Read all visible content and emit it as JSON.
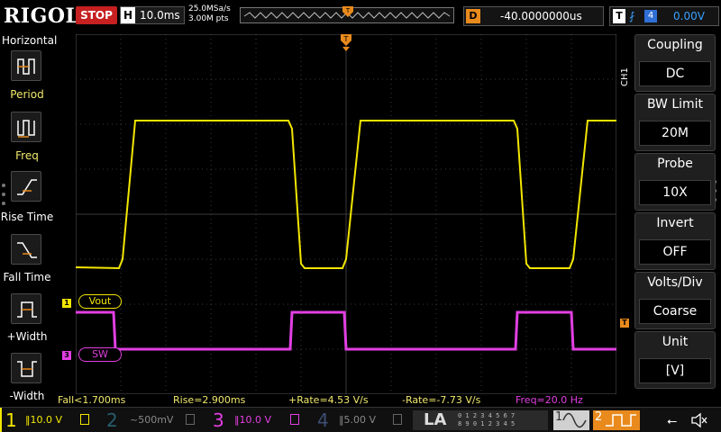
{
  "header": {
    "brand": "RIGOL",
    "run_state": "STOP",
    "timebase_label": "H",
    "timebase_value": "10.0ms",
    "sample_rate": "25.0MSa/s",
    "memory_depth": "3.00M pts",
    "delay_label": "D",
    "delay_value": "-40.0000000us",
    "trigger_label": "T",
    "trigger_source": "4",
    "trigger_level": "0.00V"
  },
  "left_menu": {
    "title": "Horizontal",
    "items": [
      {
        "label": "Period",
        "icon": "period-icon"
      },
      {
        "label": "Freq",
        "icon": "freq-icon"
      },
      {
        "label": "Rise Time",
        "icon": "rise-time-icon"
      },
      {
        "label": "Fall Time",
        "icon": "fall-time-icon"
      },
      {
        "label": "+Width",
        "icon": "pos-width-icon"
      },
      {
        "label": "-Width",
        "icon": "neg-width-icon"
      }
    ]
  },
  "channel_labels": {
    "ch1_marker": "1",
    "ch1_label": "Vout",
    "ch3_marker": "3",
    "ch3_label": "SW"
  },
  "right_menu": {
    "channel": "CH1",
    "groups": [
      {
        "title": "Coupling",
        "value": "DC",
        "arrow": true
      },
      {
        "title": "BW Limit",
        "value": "20M",
        "arrow": false
      },
      {
        "title": "Probe",
        "value": "10X",
        "arrow": true
      },
      {
        "title": "Invert",
        "value": "OFF",
        "arrow": false
      },
      {
        "title": "Volts/Div",
        "value": "Coarse",
        "arrow": false
      },
      {
        "title": "Unit",
        "value": "[V]",
        "arrow": true
      }
    ]
  },
  "measurements": [
    {
      "text": "Fall<1.700ms",
      "color": "#f0e86a"
    },
    {
      "text": "Rise=2.900ms",
      "color": "#f0e86a"
    },
    {
      "text": "+Rate=4.53 V/s",
      "color": "#f0e86a"
    },
    {
      "text": "-Rate=-7.73 V/s",
      "color": "#f0e86a"
    },
    {
      "text": "Freq=20.0 Hz",
      "color": "#e23fe2"
    }
  ],
  "channels": [
    {
      "num": "1",
      "scale": "10.0 V",
      "color": "#f2e600",
      "active": true
    },
    {
      "num": "2",
      "scale": "500mV",
      "color": "#3fa9c9",
      "active": false
    },
    {
      "num": "3",
      "scale": "10.0 V",
      "color": "#e23fe2",
      "active": true
    },
    {
      "num": "4",
      "scale": "5.00 V",
      "color": "#6a8dd8",
      "active": false
    }
  ],
  "la": {
    "label": "LA",
    "grid_row1": "0 1 2 3   4 5 6 7",
    "grid_row2": "8 9 0 1   2 3 4 5"
  },
  "generators": [
    {
      "num": "1",
      "icon": "sine-wave-icon"
    },
    {
      "num": "2",
      "icon": "square-wave-icon"
    }
  ],
  "colors": {
    "ch1": "#f2e600",
    "ch3": "#e23fe2",
    "trigger": "#e98a1d",
    "accent": "#3aa0ff",
    "stop": "#c62020"
  }
}
